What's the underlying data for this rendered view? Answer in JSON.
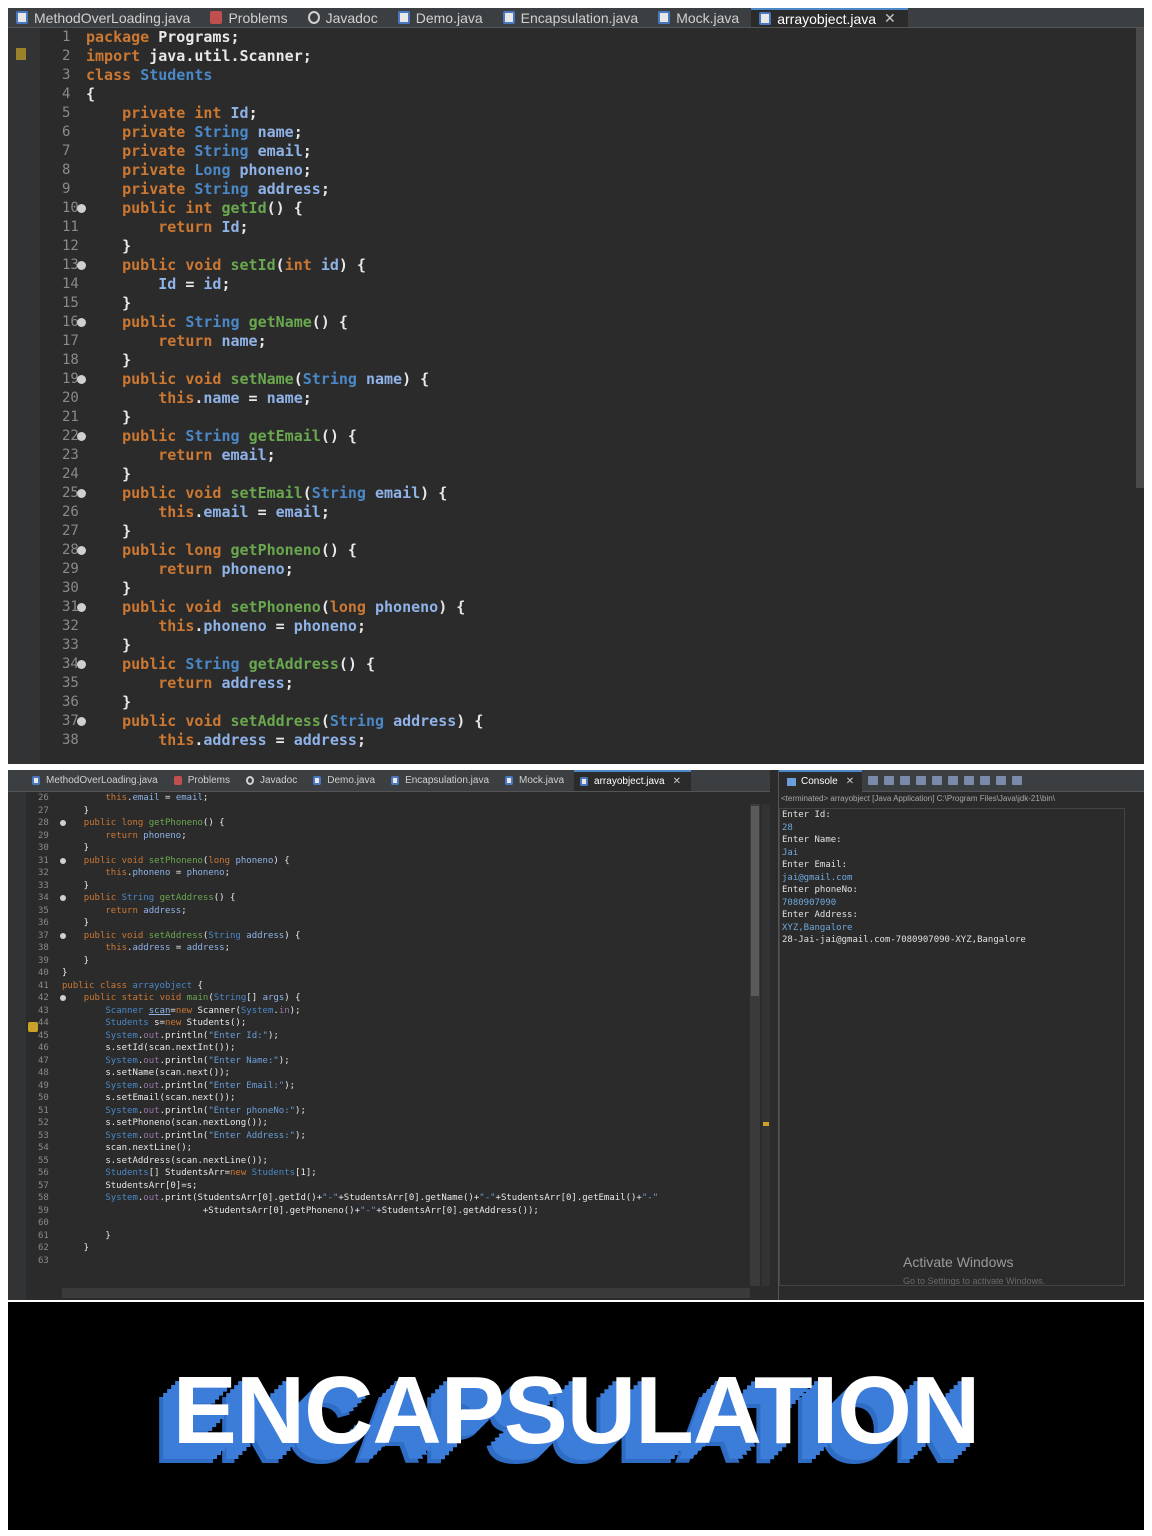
{
  "editor_tabs": [
    {
      "label": "MethodOverLoading.java",
      "icon": "java-file-icon"
    },
    {
      "label": "Problems",
      "icon": "problems-icon"
    },
    {
      "label": "Javadoc",
      "icon": "javadoc-icon"
    },
    {
      "label": "Demo.java",
      "icon": "java-file-icon"
    },
    {
      "label": "Encapsulation.java",
      "icon": "java-file-icon"
    },
    {
      "label": "Mock.java",
      "icon": "java-file-icon"
    },
    {
      "label": "arrayobject.java",
      "icon": "java-file-icon",
      "active": true
    }
  ],
  "close_glyph": "✕",
  "panel1": {
    "gutter": [
      "1",
      "2",
      "3",
      "4",
      "5",
      "6",
      "7",
      "8",
      "9",
      "10",
      "11",
      "12",
      "13",
      "14",
      "15",
      "16",
      "17",
      "18",
      "19",
      "20",
      "21",
      "22",
      "23",
      "24",
      "25",
      "26",
      "27",
      "28",
      "29",
      "30",
      "31",
      "32",
      "33",
      "34",
      "35",
      "36",
      "37",
      "38"
    ],
    "fold_markers": [
      9,
      12,
      15,
      18,
      21,
      24,
      27,
      30,
      33,
      36
    ]
  },
  "panel2": {
    "gutter": [
      "26",
      "27",
      "28",
      "29",
      "30",
      "31",
      "32",
      "33",
      "34",
      "35",
      "36",
      "37",
      "38",
      "39",
      "40",
      "41",
      "42",
      "43",
      "44",
      "45",
      "46",
      "47",
      "48",
      "49",
      "50",
      "51",
      "52",
      "53",
      "54",
      "55",
      "56",
      "57",
      "58",
      "59",
      "60",
      "61",
      "62",
      "63"
    ],
    "fold_markers": [
      2,
      5,
      8,
      11,
      16
    ]
  },
  "console": {
    "tab_label": "Console",
    "status": "<terminated> arrayobject [Java Application] C:\\Program Files\\Java\\jdk-21\\bin\\",
    "lines": [
      {
        "text": "Enter Id:",
        "kind": "out"
      },
      {
        "text": "28",
        "kind": "in"
      },
      {
        "text": "Enter Name:",
        "kind": "out"
      },
      {
        "text": "Jai",
        "kind": "in"
      },
      {
        "text": "Enter Email:",
        "kind": "out"
      },
      {
        "text": "jai@gmail.com",
        "kind": "in"
      },
      {
        "text": "Enter phoneNo:",
        "kind": "out"
      },
      {
        "text": "7080907090",
        "kind": "in"
      },
      {
        "text": "Enter Address:",
        "kind": "out"
      },
      {
        "text": "XYZ,Bangalore",
        "kind": "in"
      },
      {
        "text": "28-Jai-jai@gmail.com-7080907090-XYZ,Bangalore",
        "kind": "out"
      }
    ]
  },
  "watermark": {
    "title": "Activate Windows",
    "subtitle": "Go to Settings to activate Windows."
  },
  "banner": {
    "text": "ENCAPSULATION"
  },
  "colors": {
    "editor_bg": "#2b2b2b",
    "keyword": "#cc7832",
    "type": "#4a88c7",
    "method": "#6aa84f",
    "banner_shadow": "#3b7dd8"
  }
}
